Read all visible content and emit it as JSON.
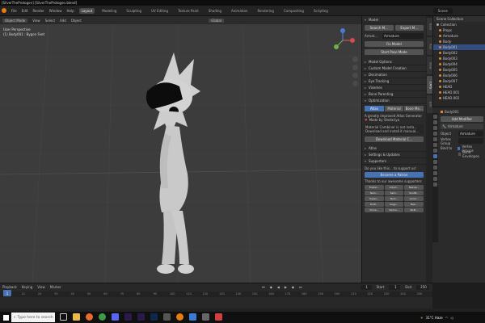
{
  "window": {
    "title": "[SilverTheProtogen] [SilverTheProtogen.blend]"
  },
  "menu": {
    "items": [
      "File",
      "Edit",
      "Render",
      "Window",
      "Help"
    ]
  },
  "workspaces": [
    "Layout",
    "Modeling",
    "Sculpting",
    "UV Editing",
    "Texture Paint",
    "Shading",
    "Animation",
    "Rendering",
    "Compositing",
    "Scripting"
  ],
  "scene": {
    "name": "Scene"
  },
  "viewport": {
    "header_items": [
      "View",
      "Select",
      "Add",
      "Object"
    ],
    "mode": "Object Mode",
    "info_line1": "User Perspective",
    "info_line2": "(1) Body001 : Bygon Feet",
    "shading_label": "Global"
  },
  "npanel": {
    "mode_header": "Model",
    "btn_search": "Search M...",
    "btn_export": "Export M...",
    "armature_label": "Armat...",
    "armature_value": "Armature",
    "fix_model": "Fix Model",
    "start_pose": "Start Pose Mode",
    "sections": [
      "Model Options",
      "Custom Model Creation",
      "Decimation",
      "Eye Tracking",
      "Visemes",
      "Bone Parenting",
      "Optimization"
    ],
    "opt_tabs": [
      "Atlas",
      "Material",
      "Bone Me..."
    ],
    "opt_text": "A greatly improved Atlas Generator",
    "opt_subtext": "Made by Shotariya",
    "opt_note": "Material Combiner is not insta... Download and install it manual...",
    "download_btn": "Download Material C...",
    "lower_sections": [
      "Atlas",
      "Settings & Updates",
      "Supporters"
    ],
    "supporter_text": "Do you like this... to support us!",
    "become_patron": "Become a Patron",
    "thanks": "Thanks to our awesome supporters",
    "supporters": [
      "Freder...",
      "Arturt...",
      "Nekup...",
      "Nero...",
      "Sero...",
      "SoulM...",
      "Super...",
      "Tanki...",
      "Lonar...",
      "Doitl...",
      "Gogo...",
      "Bas...",
      "Vince...",
      "Samui...",
      "SiLB..."
    ],
    "tabs": [
      "Item",
      "Tool",
      "View",
      "CATS",
      "Edit"
    ]
  },
  "outliner": {
    "header": "Scene Collection",
    "items": [
      "Collection",
      "Props",
      "Armature",
      "Body",
      "Body001",
      "Body002",
      "Body003",
      "Body004",
      "Body005",
      "Body006",
      "Body007",
      "HEAD",
      "HEAD.001",
      "HEAD.002"
    ]
  },
  "properties": {
    "object": "Body001",
    "modifier_add": "Add Modifier",
    "modifier_name": "Armature",
    "field_object": "Object",
    "field_object_value": "Armature",
    "vertex_group": "Vertex Group",
    "bind_to": "Bind to",
    "preserve_volume": "Preserve Volume",
    "vertex_groups": "Vertex Groups",
    "bone_envelopes": "Bone Envelopes"
  },
  "timeline": {
    "header_items": [
      "Playback",
      "Keying",
      "View",
      "Marker"
    ],
    "current_frame": "1",
    "start": "1",
    "end": "250",
    "start_label": "Start",
    "end_label": "End",
    "ticks": [
      "0",
      "10",
      "20",
      "30",
      "40",
      "50",
      "60",
      "70",
      "80",
      "90",
      "100",
      "110",
      "120",
      "130",
      "140",
      "150",
      "160",
      "170",
      "180",
      "190",
      "200",
      "210",
      "220",
      "230",
      "240",
      "250"
    ]
  },
  "taskbar": {
    "search_placeholder": "Type here to search",
    "weather": "31°C  Haze",
    "time": "",
    "accent": "#0078d4"
  },
  "colors": {
    "accent": "#4772b3",
    "viewport_bg": "#3c3c3c",
    "orange": "#e08a2c"
  }
}
